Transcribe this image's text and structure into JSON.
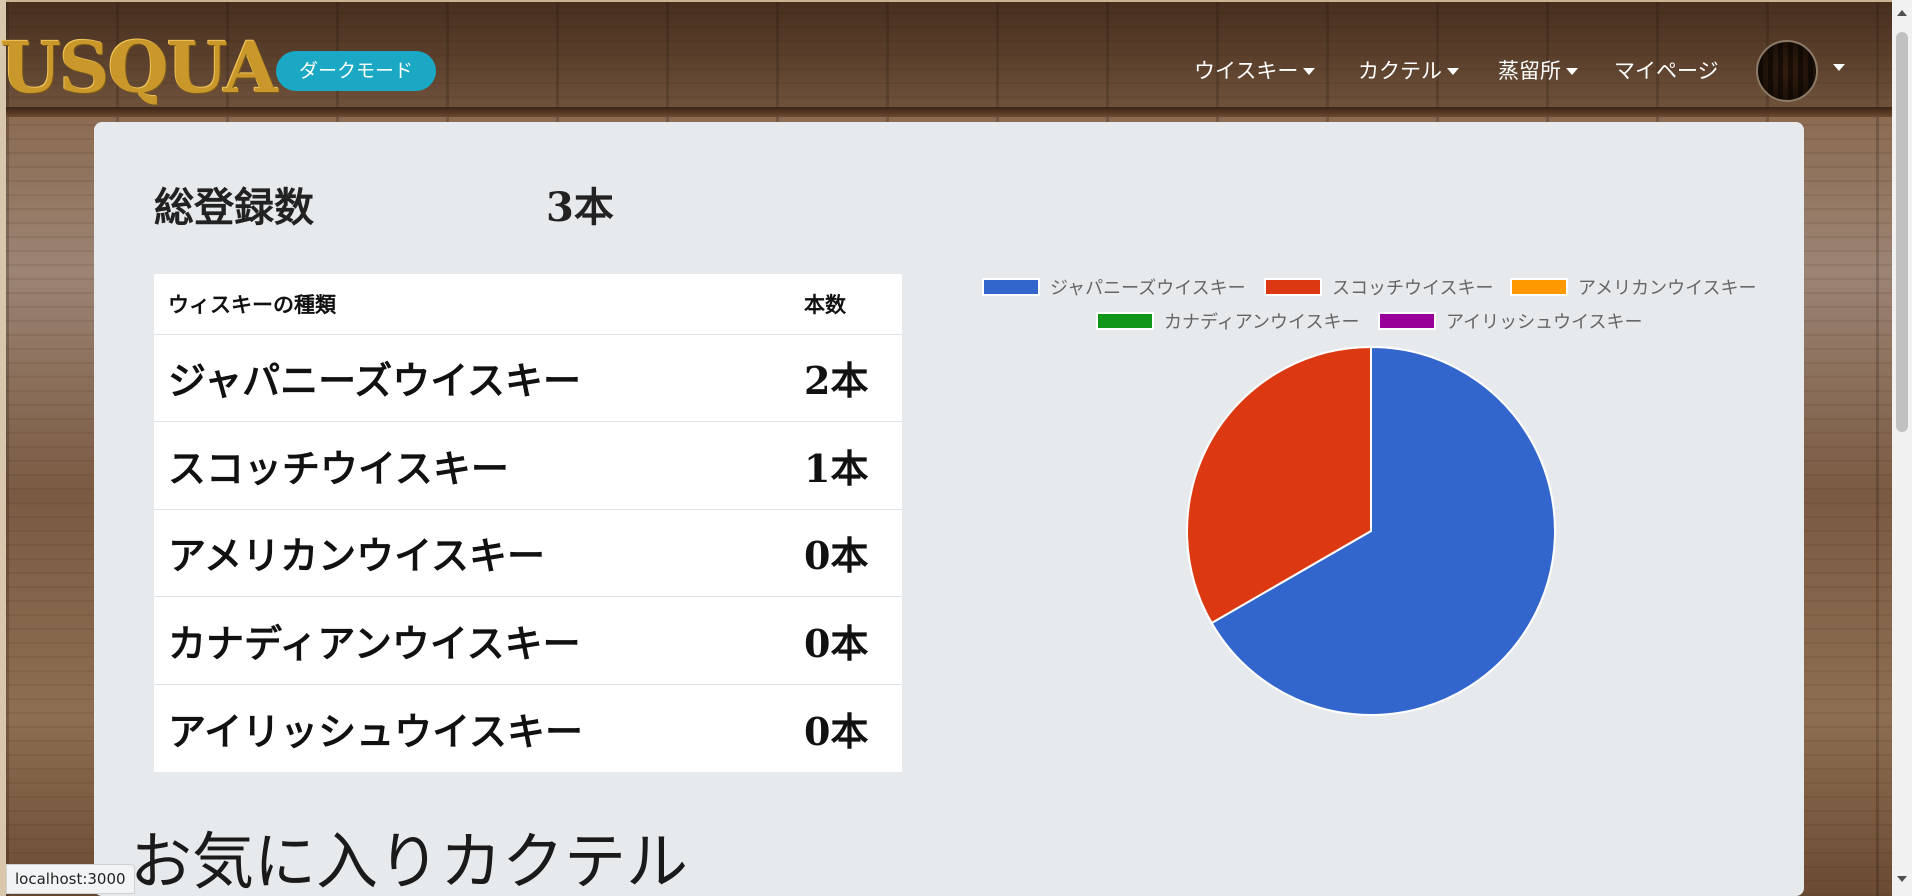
{
  "navbar": {
    "brand": "USQUA",
    "dark_mode_label": "ダークモード",
    "items": [
      {
        "label": "ウイスキー"
      },
      {
        "label": "カクテル"
      },
      {
        "label": "蒸留所"
      },
      {
        "label": "マイページ"
      }
    ]
  },
  "summary": {
    "total_label": "総登録数",
    "total_value": "3本"
  },
  "table": {
    "headers": [
      "ウィスキーの種類",
      "本数"
    ],
    "rows": [
      {
        "type": "ジャパニーズウイスキー",
        "count": "2本"
      },
      {
        "type": "スコッチウイスキー",
        "count": "1本"
      },
      {
        "type": "アメリカンウイスキー",
        "count": "0本"
      },
      {
        "type": "カナディアンウイスキー",
        "count": "0本"
      },
      {
        "type": "アイリッシュウイスキー",
        "count": "0本"
      }
    ]
  },
  "chart_data": {
    "type": "pie",
    "categories": [
      "ジャパニーズウイスキー",
      "スコッチウイスキー",
      "アメリカンウイスキー",
      "カナディアンウイスキー",
      "アイリッシュウイスキー"
    ],
    "values": [
      2,
      1,
      0,
      0,
      0
    ],
    "colors": [
      "#3366cc",
      "#dc3912",
      "#ff9900",
      "#109618",
      "#990099"
    ],
    "legend": "top"
  },
  "favorites": {
    "title": "お気に入りカクテル"
  },
  "status_bar": {
    "url": "localhost:3000"
  }
}
